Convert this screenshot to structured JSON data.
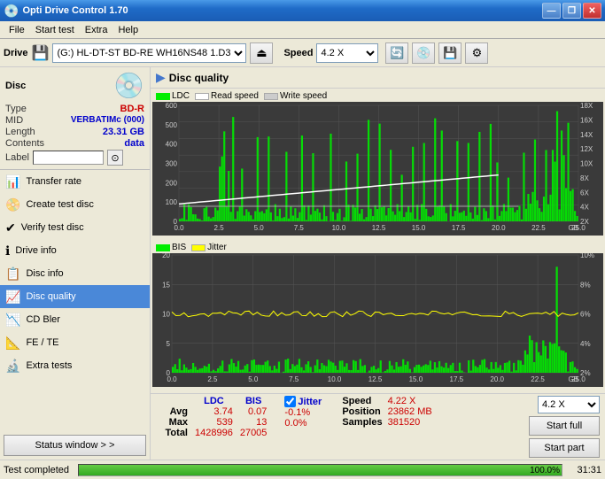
{
  "titlebar": {
    "title": "Opti Drive Control 1.70",
    "icon": "💿",
    "min_label": "—",
    "max_label": "❐",
    "close_label": "✕"
  },
  "menubar": {
    "items": [
      "File",
      "Start test",
      "Extra",
      "Help"
    ]
  },
  "drivebar": {
    "drive_label": "Drive",
    "drive_value": "(G:)  HL-DT-ST BD-RE  WH16NS48 1.D3",
    "speed_label": "Speed",
    "speed_value": "4.2 X"
  },
  "disc_info": {
    "type_label": "Type",
    "type_value": "BD-R",
    "mid_label": "MID",
    "mid_value": "VERBATIMc (000)",
    "length_label": "Length",
    "length_value": "23.31 GB",
    "contents_label": "Contents",
    "contents_value": "data",
    "label_label": "Label"
  },
  "nav_items": [
    {
      "id": "transfer-rate",
      "label": "Transfer rate"
    },
    {
      "id": "create-test-disc",
      "label": "Create test disc"
    },
    {
      "id": "verify-test-disc",
      "label": "Verify test disc"
    },
    {
      "id": "drive-info",
      "label": "Drive info"
    },
    {
      "id": "disc-info",
      "label": "Disc info"
    },
    {
      "id": "disc-quality",
      "label": "Disc quality",
      "active": true
    },
    {
      "id": "cd-bler",
      "label": "CD Bler"
    },
    {
      "id": "fe-te",
      "label": "FE / TE"
    },
    {
      "id": "extra-tests",
      "label": "Extra tests"
    }
  ],
  "status_window_btn": "Status window > >",
  "disc_quality": {
    "title": "Disc quality",
    "legend": {
      "ldc_label": "LDC",
      "read_speed_label": "Read speed",
      "write_speed_label": "Write speed",
      "bis_label": "BIS",
      "jitter_label": "Jitter"
    },
    "chart1": {
      "y_max": 600,
      "y_labels_left": [
        "600",
        "500",
        "400",
        "300",
        "200",
        "100",
        "0"
      ],
      "y_labels_right": [
        "18X",
        "16X",
        "14X",
        "12X",
        "10X",
        "8X",
        "6X",
        "4X",
        "2X"
      ],
      "x_labels": [
        "0.0",
        "2.5",
        "5.0",
        "7.5",
        "10.0",
        "12.5",
        "15.0",
        "17.5",
        "20.0",
        "22.5",
        "25.0 GB"
      ]
    },
    "chart2": {
      "y_max": 20,
      "y_labels_left": [
        "20",
        "15",
        "10",
        "5",
        "0"
      ],
      "y_labels_right": [
        "10%",
        "8%",
        "6%",
        "4%",
        "2%"
      ],
      "x_labels": [
        "0.0",
        "2.5",
        "5.0",
        "7.5",
        "10.0",
        "12.5",
        "15.0",
        "17.5",
        "20.0",
        "22.5",
        "25.0 GB"
      ]
    }
  },
  "stats": {
    "ldc_header": "LDC",
    "bis_header": "BIS",
    "avg_label": "Avg",
    "avg_ldc": "3.74",
    "avg_bis": "0.07",
    "max_label": "Max",
    "max_ldc": "539",
    "max_bis": "13",
    "total_label": "Total",
    "total_ldc": "1428996",
    "total_bis": "27005",
    "jitter_checked": true,
    "jitter_header": "Jitter",
    "avg_jitter": "-0.1%",
    "max_jitter": "0.0%",
    "speed_label": "Speed",
    "speed_value": "4.22 X",
    "position_label": "Position",
    "position_value": "23862 MB",
    "samples_label": "Samples",
    "samples_value": "381520",
    "speed_dropdown": "4.2 X",
    "start_full_btn": "Start full",
    "start_part_btn": "Start part"
  },
  "progress": {
    "label": "Test completed",
    "percent": "100.0%",
    "time": "31:31"
  },
  "colors": {
    "ldc_bar": "#00ee00",
    "read_speed_line": "#ffffff",
    "write_speed_line": "#ffffff",
    "bis_bar": "#00ee00",
    "jitter_line": "#ffff00",
    "chart_bg": "#3a3a3a",
    "grid": "#555555"
  }
}
